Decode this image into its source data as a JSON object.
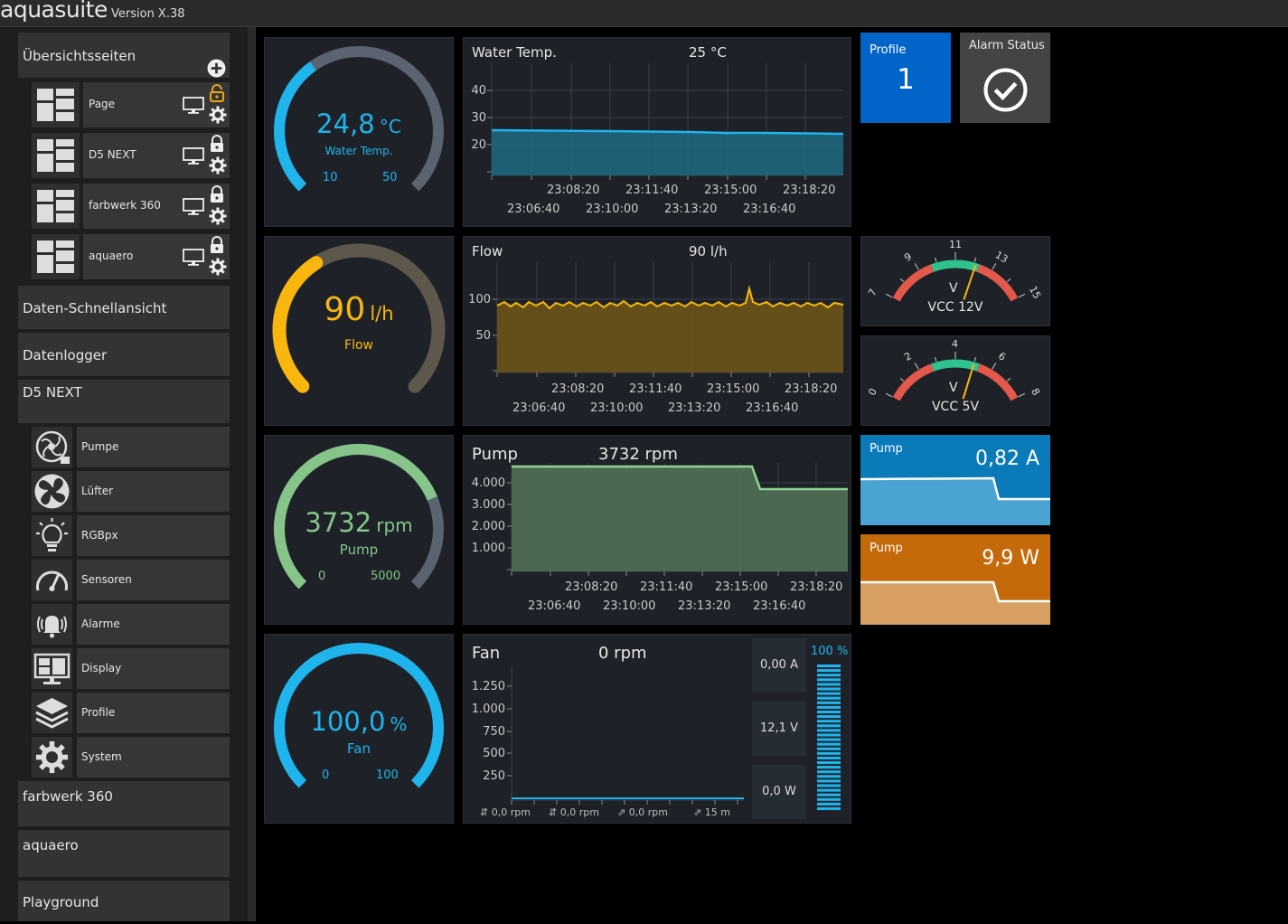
{
  "app": {
    "name": "aquasuite",
    "version": "Version X.38"
  },
  "sidebar": {
    "overview_title": "Übersichtsseiten",
    "pages": [
      {
        "label": "Page"
      },
      {
        "label": "D5 NEXT"
      },
      {
        "label": "farbwerk 360"
      },
      {
        "label": "aquaero"
      }
    ],
    "quick_view": "Daten-Schnellansicht",
    "datalogger": "Datenlogger",
    "device": "D5 NEXT",
    "device_items": [
      {
        "label": "Pumpe"
      },
      {
        "label": "Lüfter"
      },
      {
        "label": "RGBpx"
      },
      {
        "label": "Sensoren"
      },
      {
        "label": "Alarme"
      },
      {
        "label": "Display"
      },
      {
        "label": "Profile"
      },
      {
        "label": "System"
      }
    ],
    "farbwerk": "farbwerk 360",
    "aquaero": "aquaero",
    "playground": "Playground"
  },
  "gauges": {
    "water": {
      "value": "24,8",
      "unit": "°C",
      "label": "Water Temp.",
      "min": "10",
      "max": "50",
      "fraction": 0.37,
      "color": "#1fb4ec"
    },
    "flow": {
      "value": "90",
      "unit": "l/h",
      "label": "Flow",
      "fraction": 0.38,
      "color": "#f8b60e"
    },
    "pump": {
      "value": "3732",
      "unit": "rpm",
      "label": "Pump",
      "min": "0",
      "max": "5000",
      "fraction": 0.75,
      "color": "#86c48a"
    },
    "fan": {
      "value": "100,0",
      "unit": "%",
      "label": "Fan",
      "min": "0",
      "max": "100",
      "fraction": 1.0,
      "color": "#1fb4ec"
    }
  },
  "charts": {
    "water": {
      "title": "Water Temp.",
      "current": "25 °C",
      "yticks": [
        "40",
        "30",
        "20"
      ],
      "xticks_top": [
        "23:08:20",
        "23:11:40",
        "23:15:00",
        "23:18:20"
      ],
      "xticks_bottom": [
        "23:06:40",
        "23:10:00",
        "23:13:20",
        "23:16:40"
      ]
    },
    "flow": {
      "title": "Flow",
      "current": "90 l/h",
      "yticks": [
        "100",
        "50"
      ],
      "xticks_top": [
        "23:08:20",
        "23:11:40",
        "23:15:00",
        "23:18:20"
      ],
      "xticks_bottom": [
        "23:06:40",
        "23:10:00",
        "23:13:20",
        "23:16:40"
      ]
    },
    "pump": {
      "title": "Pump",
      "current": "3732 rpm",
      "yticks": [
        "4.000",
        "3.000",
        "2.000",
        "1.000"
      ],
      "xticks_top": [
        "23:08:20",
        "23:11:40",
        "23:15:00",
        "23:18:20"
      ],
      "xticks_bottom": [
        "23:06:40",
        "23:10:00",
        "23:13:20",
        "23:16:40"
      ]
    },
    "fan": {
      "title": "Fan",
      "current": "0 rpm",
      "yticks": [
        "1.250",
        "1.000",
        "750",
        "500",
        "250"
      ],
      "xlabels": [
        "0,0 rpm",
        "0,0 rpm",
        "0,0 rpm",
        "15 m"
      ],
      "stats": [
        "0,00 A",
        "12,1 V",
        "0,0 W"
      ],
      "bar_label": "100 %",
      "bar_fraction": 1.0
    }
  },
  "tiles": {
    "profile": {
      "label": "Profile",
      "value": "1"
    },
    "alarm": {
      "label": "Alarm Status"
    },
    "vcc12": {
      "unit": "V",
      "label": "VCC 12V",
      "scale": [
        "7",
        "9",
        "11",
        "13",
        "15"
      ],
      "reading": 12.1,
      "min": 7,
      "max": 15
    },
    "vcc5": {
      "unit": "V",
      "label": "VCC 5V",
      "scale": [
        "0",
        "2",
        "4",
        "6",
        "8"
      ],
      "reading": 5.0,
      "min": 0,
      "max": 8
    },
    "current": {
      "label": "Pump",
      "value": "0,82 A"
    },
    "power": {
      "label": "Pump",
      "value": "9,9 W"
    }
  }
}
